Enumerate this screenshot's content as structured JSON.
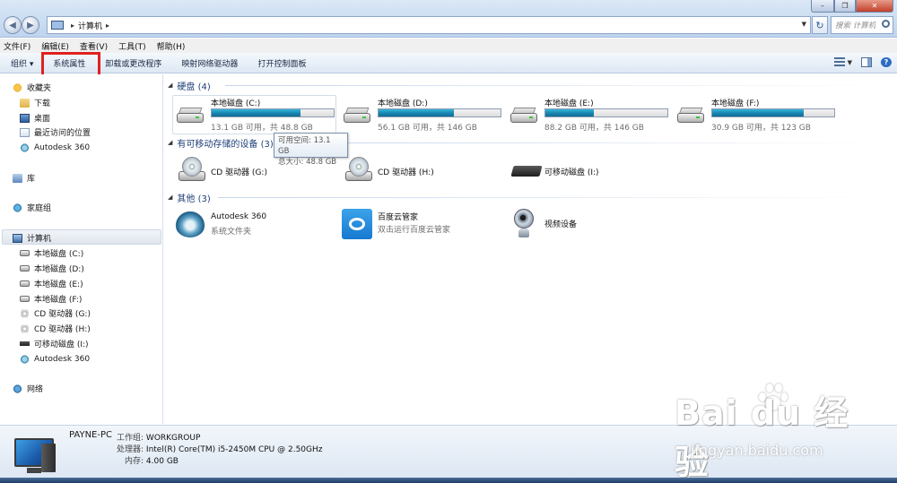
{
  "address": {
    "location": "计算机",
    "search_placeholder": "搜索 计算机"
  },
  "menu": [
    "文件(F)",
    "编辑(E)",
    "查看(V)",
    "工具(T)",
    "帮助(H)"
  ],
  "commands": {
    "organize": "组织 ▾",
    "system_properties": "系统属性",
    "uninstall": "卸载或更改程序",
    "map_drive": "映射网络驱动器",
    "control_panel": "打开控制面板"
  },
  "nav": {
    "favorites": "收藏夹",
    "downloads": "下载",
    "desktop": "桌面",
    "recent": "最近访问的位置",
    "autodesk": "Autodesk 360",
    "libraries": "库",
    "homegroup": "家庭组",
    "computer": "计算机",
    "drives": [
      "本地磁盘 (C:)",
      "本地磁盘 (D:)",
      "本地磁盘 (E:)",
      "本地磁盘 (F:)",
      "CD 驱动器 (G:)",
      "CD 驱动器 (H:)",
      "可移动磁盘 (I:)",
      "Autodesk 360"
    ],
    "network": "网络"
  },
  "groups": {
    "hdd": "硬盘 (4)",
    "removable": "有可移动存储的设备 (3)",
    "other": "其他 (3)"
  },
  "hard_drives": [
    {
      "name": "本地磁盘 (C:)",
      "info": "13.1 GB 可用，共 48.8 GB",
      "used_fraction": 0.73
    },
    {
      "name": "本地磁盘 (D:)",
      "info": "56.1 GB 可用，共 146 GB",
      "used_fraction": 0.62
    },
    {
      "name": "本地磁盘 (E:)",
      "info": "88.2 GB 可用，共 146 GB",
      "used_fraction": 0.4
    },
    {
      "name": "本地磁盘 (F:)",
      "info": "30.9 GB 可用，共 123 GB",
      "used_fraction": 0.75
    }
  ],
  "tooltip": {
    "line1": "可用空间: 13.1 GB",
    "line2": "总大小: 48.8 GB"
  },
  "removable": [
    "CD 驱动器 (G:)",
    "CD 驱动器 (H:)",
    "可移动磁盘 (I:)"
  ],
  "others": [
    {
      "name": "Autodesk 360",
      "sub": "系统文件夹"
    },
    {
      "name": "百度云管家",
      "sub": "双击运行百度云管家"
    },
    {
      "name": "视频设备",
      "sub": ""
    }
  ],
  "details": {
    "pc_name": "PAYNE-PC",
    "workgroup_label": "工作组:",
    "workgroup": "WORKGROUP",
    "cpu_label": "处理器:",
    "cpu": "Intel(R) Core(TM) i5-2450M CPU @ 2.50GHz",
    "mem_label": "内存:",
    "mem": "4.00 GB"
  },
  "watermark": {
    "main": "Bai du 经验",
    "sub": "jingyan.baidu.com"
  }
}
